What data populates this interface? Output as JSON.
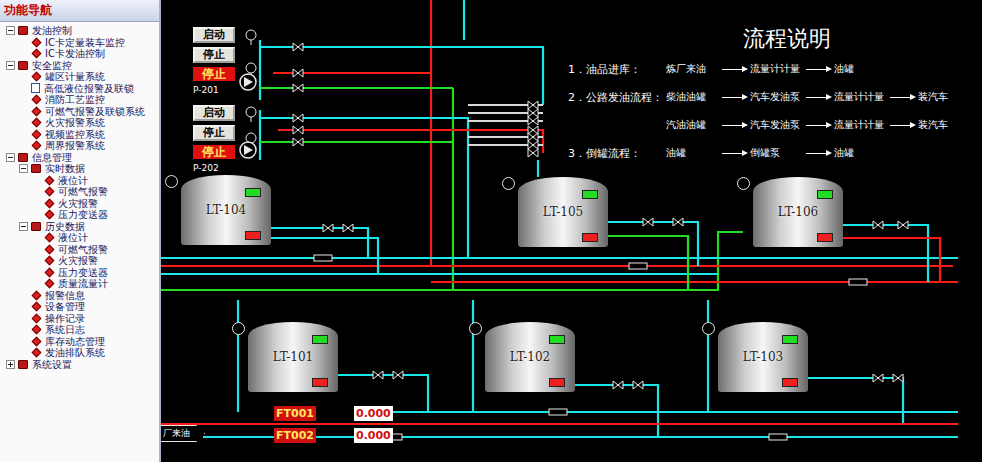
{
  "sidebar": {
    "title": "功能导航",
    "items": [
      {
        "label": "发油控制",
        "depth": 0,
        "kind": "group",
        "has_children": true,
        "expanded": true
      },
      {
        "label": "IC卡定量装车监控",
        "depth": 1,
        "kind": "item",
        "has_children": false,
        "expanded": false
      },
      {
        "label": "IC卡发油控制",
        "depth": 1,
        "kind": "item",
        "has_children": false,
        "expanded": false
      },
      {
        "label": "安全监控",
        "depth": 0,
        "kind": "group",
        "has_children": true,
        "expanded": true
      },
      {
        "label": "罐区计量系统",
        "depth": 1,
        "kind": "item",
        "has_children": false,
        "expanded": false
      },
      {
        "label": "高低液位报警及联锁",
        "depth": 1,
        "kind": "doc",
        "has_children": false,
        "expanded": false
      },
      {
        "label": "消防工艺监控",
        "depth": 1,
        "kind": "item",
        "has_children": false,
        "expanded": false
      },
      {
        "label": "可燃气报警及联锁系统",
        "depth": 1,
        "kind": "item",
        "has_children": false,
        "expanded": false
      },
      {
        "label": "火灾报警系统",
        "depth": 1,
        "kind": "item",
        "has_children": false,
        "expanded": false
      },
      {
        "label": "视频监控系统",
        "depth": 1,
        "kind": "item",
        "has_children": false,
        "expanded": false
      },
      {
        "label": "周界报警系统",
        "depth": 1,
        "kind": "item",
        "has_children": false,
        "expanded": false
      },
      {
        "label": "信息管理",
        "depth": 0,
        "kind": "group",
        "has_children": true,
        "expanded": true
      },
      {
        "label": "实时数据",
        "depth": 1,
        "kind": "group",
        "has_children": true,
        "expanded": true
      },
      {
        "label": "液位计",
        "depth": 2,
        "kind": "item",
        "has_children": false,
        "expanded": false
      },
      {
        "label": "可燃气报警",
        "depth": 2,
        "kind": "item",
        "has_children": false,
        "expanded": false
      },
      {
        "label": "火灾报警",
        "depth": 2,
        "kind": "item",
        "has_children": false,
        "expanded": false
      },
      {
        "label": "压力变送器",
        "depth": 2,
        "kind": "item",
        "has_children": false,
        "expanded": false
      },
      {
        "label": "历史数据",
        "depth": 1,
        "kind": "group",
        "has_children": true,
        "expanded": true
      },
      {
        "label": "液位计",
        "depth": 2,
        "kind": "item",
        "has_children": false,
        "expanded": false
      },
      {
        "label": "可燃气报警",
        "depth": 2,
        "kind": "item",
        "has_children": false,
        "expanded": false
      },
      {
        "label": "火灾报警",
        "depth": 2,
        "kind": "item",
        "has_children": false,
        "expanded": false
      },
      {
        "label": "压力变送器",
        "depth": 2,
        "kind": "item",
        "has_children": false,
        "expanded": false
      },
      {
        "label": "质量流量计",
        "depth": 2,
        "kind": "item",
        "has_children": false,
        "expanded": false
      },
      {
        "label": "报警信息",
        "depth": 1,
        "kind": "item",
        "has_children": false,
        "expanded": false
      },
      {
        "label": "设备管理",
        "depth": 1,
        "kind": "item",
        "has_children": false,
        "expanded": false
      },
      {
        "label": "操作记录",
        "depth": 1,
        "kind": "item",
        "has_children": false,
        "expanded": false
      },
      {
        "label": "系统日志",
        "depth": 1,
        "kind": "item",
        "has_children": false,
        "expanded": false
      },
      {
        "label": "库存动态管理",
        "depth": 1,
        "kind": "item",
        "has_children": false,
        "expanded": false
      },
      {
        "label": "发油排队系统",
        "depth": 1,
        "kind": "item",
        "has_children": false,
        "expanded": false
      },
      {
        "label": "系统设置",
        "depth": 0,
        "kind": "group",
        "has_children": true,
        "expanded": false
      }
    ]
  },
  "pumps": [
    {
      "name": "P-201",
      "start_label": "启动",
      "stop_label": "停止",
      "status": "停止",
      "running": false
    },
    {
      "name": "P-202",
      "start_label": "启动",
      "stop_label": "停止",
      "status": "停止",
      "running": false
    }
  ],
  "tanks": [
    {
      "name": "LT-104",
      "upper_lamp": true,
      "lower_lamp": true
    },
    {
      "name": "LT-105",
      "upper_lamp": true,
      "lower_lamp": true
    },
    {
      "name": "LT-106",
      "upper_lamp": true,
      "lower_lamp": true
    },
    {
      "name": "LT-101",
      "upper_lamp": true,
      "lower_lamp": true
    },
    {
      "name": "LT-102",
      "upper_lamp": true,
      "lower_lamp": true
    },
    {
      "name": "LT-103",
      "upper_lamp": true,
      "lower_lamp": true
    }
  ],
  "flow_notes": {
    "title": "流程说明",
    "steps": [
      {
        "number": "1．",
        "name": "油品进库：",
        "chains": [
          [
            "炼厂来油",
            "流量计计量",
            "油罐"
          ]
        ]
      },
      {
        "number": "2．",
        "name": "公路发油流程：",
        "chains": [
          [
            "柴油油罐",
            "汽车发油泵",
            "流量计计量",
            "装汽车"
          ],
          [
            "汽油油罐",
            "汽车发油泵",
            "流量计计量",
            "装汽车"
          ]
        ]
      },
      {
        "number": "3．",
        "name": "倒罐流程：",
        "chains": [
          [
            "油罐",
            "倒罐泵",
            "油罐"
          ]
        ]
      }
    ]
  },
  "flowmeters": [
    {
      "name": "FT001",
      "value": "0.000"
    },
    {
      "name": "FT002",
      "value": "0.000"
    }
  ],
  "inlet_label": "厂来油"
}
